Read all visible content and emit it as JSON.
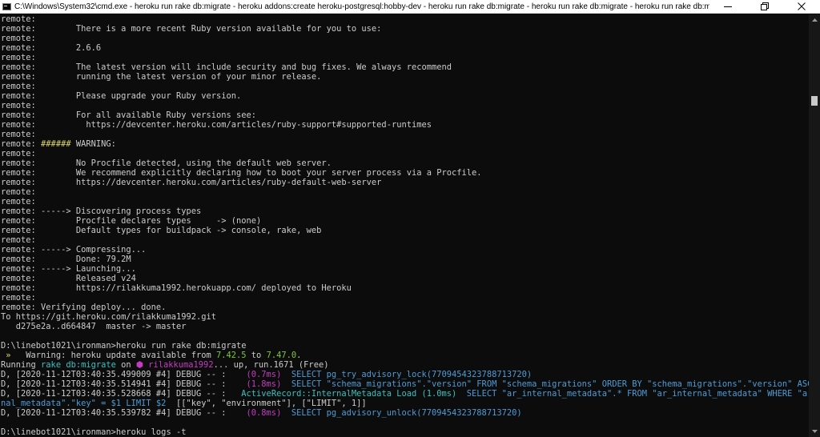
{
  "window": {
    "title": "C:\\Windows\\System32\\cmd.exe - heroku  run rake db:migrate - heroku  addons:create heroku-postgresql:hobby-dev - heroku  run rake db:migrate - heroku  run rake db:migrate - heroku  run rake db:migrate - her...",
    "controls": [
      "minimize-icon",
      "restore-icon",
      "close-icon"
    ]
  },
  "console": {
    "lines": [
      [
        {
          "t": "remote:"
        }
      ],
      [
        {
          "t": "remote:        There is a more recent Ruby version available for you to use:"
        }
      ],
      [
        {
          "t": "remote:"
        }
      ],
      [
        {
          "t": "remote:        2.6.6"
        }
      ],
      [
        {
          "t": "remote:"
        }
      ],
      [
        {
          "t": "remote:        The latest version will include security and bug fixes. We always recommend"
        }
      ],
      [
        {
          "t": "remote:        running the latest version of your minor release."
        }
      ],
      [
        {
          "t": "remote:"
        }
      ],
      [
        {
          "t": "remote:        Please upgrade your Ruby version."
        }
      ],
      [
        {
          "t": "remote:"
        }
      ],
      [
        {
          "t": "remote:        For all available Ruby versions see:"
        }
      ],
      [
        {
          "t": "remote:          https://devcenter.heroku.com/articles/ruby-support#supported-runtimes"
        }
      ],
      [
        {
          "t": "remote:"
        }
      ],
      [
        {
          "t": "remote: "
        },
        {
          "t": "######",
          "c": "yellow"
        },
        {
          "t": " WARNING:"
        }
      ],
      [
        {
          "t": "remote:"
        }
      ],
      [
        {
          "t": "remote:        No Procfile detected, using the default web server."
        }
      ],
      [
        {
          "t": "remote:        We recommend explicitly declaring how to boot your server process via a Procfile."
        }
      ],
      [
        {
          "t": "remote:        https://devcenter.heroku.com/articles/ruby-default-web-server"
        }
      ],
      [
        {
          "t": "remote:"
        }
      ],
      [
        {
          "t": "remote:"
        }
      ],
      [
        {
          "t": "remote: -----> Discovering process types"
        }
      ],
      [
        {
          "t": "remote:        Procfile declares types     -> (none)"
        }
      ],
      [
        {
          "t": "remote:        Default types for buildpack -> console, rake, web"
        }
      ],
      [
        {
          "t": "remote:"
        }
      ],
      [
        {
          "t": "remote: -----> Compressing..."
        }
      ],
      [
        {
          "t": "remote:        Done: 79.2M"
        }
      ],
      [
        {
          "t": "remote: -----> Launching..."
        }
      ],
      [
        {
          "t": "remote:        Released v24"
        }
      ],
      [
        {
          "t": "remote:        https://rilakkuma1992.herokuapp.com/ deployed to Heroku"
        }
      ],
      [
        {
          "t": "remote:"
        }
      ],
      [
        {
          "t": "remote: Verifying deploy... done."
        }
      ],
      [
        {
          "t": "To https://git.heroku.com/rilakkuma1992.git"
        }
      ],
      [
        {
          "t": "   d275e2a..d664847  master -> master"
        }
      ],
      [
        {
          "t": ""
        }
      ],
      [
        {
          "t": "D:\\linebot1021\\ironman>heroku run rake db:migrate"
        }
      ],
      [
        {
          "t": " »   ",
          "c": "yellow"
        },
        {
          "t": "Warning: heroku update available from "
        },
        {
          "t": "7.42.5",
          "c": "green"
        },
        {
          "t": " to "
        },
        {
          "t": "7.47.0",
          "c": "green"
        },
        {
          "t": "."
        }
      ],
      [
        {
          "t": "Running "
        },
        {
          "t": "rake db:migrate",
          "c": "cyan"
        },
        {
          "t": " on "
        },
        {
          "t": "⬢ rilakkuma1992",
          "c": "magenta"
        },
        {
          "t": "... up, run.1671 (Free)"
        }
      ],
      [
        {
          "t": "D, [2020-11-12T03:40:35.499009 #4] DEBUG -- :    "
        },
        {
          "t": "(0.7ms)",
          "c": "magenta"
        },
        {
          "t": "  "
        },
        {
          "t": "SELECT pg_try_advisory_lock(7709454323788713720)",
          "c": "blue"
        }
      ],
      [
        {
          "t": "D, [2020-11-12T03:40:35.514941 #4] DEBUG -- :    "
        },
        {
          "t": "(1.8ms)",
          "c": "magenta"
        },
        {
          "t": "  "
        },
        {
          "t": "SELECT \"schema_migrations\".\"version\" FROM \"schema_migrations\" ORDER BY \"schema_migrations\".\"version\" ASC",
          "c": "blue"
        }
      ],
      [
        {
          "t": "D, [2020-11-12T03:40:35.528668 #4] DEBUG -- :   "
        },
        {
          "t": "ActiveRecord::InternalMetadata Load (1.0ms)",
          "c": "cyan"
        },
        {
          "t": "  "
        },
        {
          "t": "SELECT \"ar_internal_metadata\".* FROM \"ar_internal_metadata\" WHERE \"ar_inter",
          "c": "blue"
        }
      ],
      [
        {
          "t": "nal_metadata\".\"key\" = $1 LIMIT $2",
          "c": "blue"
        },
        {
          "t": "  [[\"key\", \"environment\"], [\"LIMIT\", 1]]"
        }
      ],
      [
        {
          "t": "D, [2020-11-12T03:40:35.539782 #4] DEBUG -- :    "
        },
        {
          "t": "(0.8ms)",
          "c": "magenta"
        },
        {
          "t": "  "
        },
        {
          "t": "SELECT pg_advisory_unlock(7709454323788713720)",
          "c": "blue"
        }
      ],
      [
        {
          "t": ""
        }
      ],
      [
        {
          "t": "D:\\linebot1021\\ironman>heroku logs -t"
        }
      ]
    ]
  },
  "scrollbar": {
    "position_fraction": 0.18
  }
}
